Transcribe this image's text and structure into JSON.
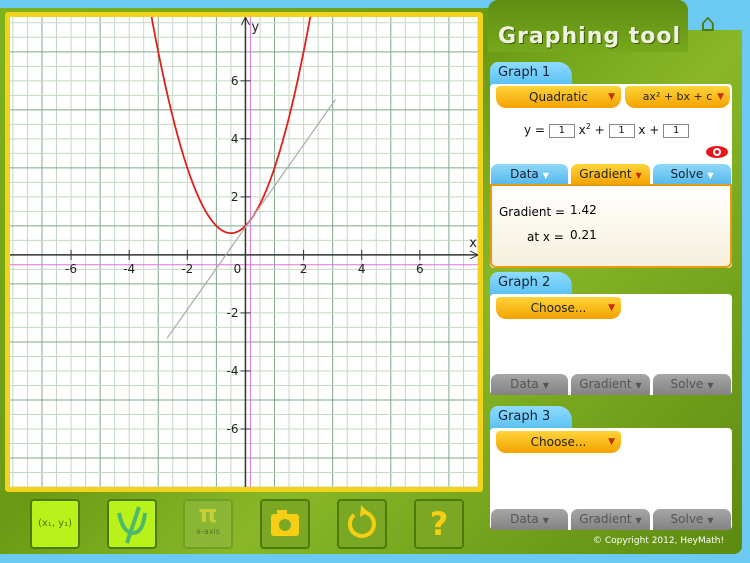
{
  "app": {
    "title": "Graphing tool",
    "home_icon": "home-icon",
    "copyright": "© Copyright 2012, HeyMath!"
  },
  "graph_area": {
    "x_axis_label": "x",
    "y_axis_label": "y",
    "x_ticks": [
      "-6",
      "-4",
      "-2",
      "0",
      "2",
      "4",
      "6"
    ],
    "y_ticks": [
      "6",
      "4",
      "2",
      "-2",
      "-4",
      "-6"
    ],
    "x_range": [
      -8.1,
      8.0
    ],
    "y_range": [
      -8.0,
      8.2
    ],
    "curve": {
      "a": 1,
      "b": 1,
      "c": 1,
      "color": "#e0201a"
    },
    "tangent": {
      "slope": 1.42,
      "at_x": 0.21,
      "x_from": -2.7,
      "x_to": 3.1,
      "color": "#aaaaaa"
    }
  },
  "graphs": [
    {
      "tab": "Graph 1",
      "type": "Quadratic",
      "form": "ax² + bx + c",
      "eq_prefix": "y =",
      "a": "1",
      "x2": "x",
      "plus1": "+",
      "b": "1",
      "x1": "x +",
      "c": "1",
      "tabs": [
        "Data",
        "Gradient",
        "Solve"
      ],
      "active_tab": "Gradient",
      "result": {
        "gradient_label": "Gradient =",
        "gradient_value": "1.42",
        "at_label": "at x =",
        "at_value": "0.21"
      }
    },
    {
      "tab": "Graph 2",
      "choose": "Choose...",
      "tabs": [
        "Data",
        "Gradient",
        "Solve"
      ]
    },
    {
      "tab": "Graph 3",
      "choose": "Choose...",
      "tabs": [
        "Data",
        "Gradient",
        "Solve"
      ]
    }
  ],
  "toolbar": {
    "point": "(x₁, y₁)",
    "pi": "π",
    "x_axis": "x-axis",
    "help": "?"
  },
  "colors": {
    "frame": "#f1d31c",
    "green": "#6a9a14",
    "tab_blue": "#58bff0",
    "dropdown": "#f3a200"
  }
}
